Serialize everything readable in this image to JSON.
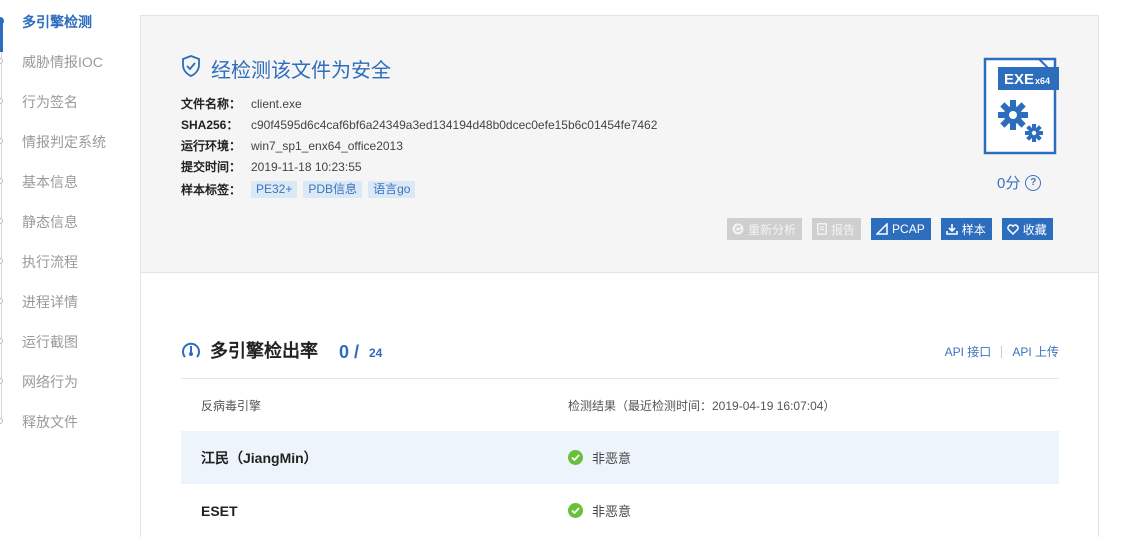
{
  "nav": {
    "items": [
      {
        "label": "多引擎检测",
        "active": true
      },
      {
        "label": "威胁情报IOC",
        "active": false
      },
      {
        "label": "行为签名",
        "active": false
      },
      {
        "label": "情报判定系统",
        "active": false
      },
      {
        "label": "基本信息",
        "active": false
      },
      {
        "label": "静态信息",
        "active": false
      },
      {
        "label": "执行流程",
        "active": false
      },
      {
        "label": "进程详情",
        "active": false
      },
      {
        "label": "运行截图",
        "active": false
      },
      {
        "label": "网络行为",
        "active": false
      },
      {
        "label": "释放文件",
        "active": false
      }
    ]
  },
  "summary": {
    "verdict": "经检测该文件为安全",
    "fields": {
      "filename_key": "文件名称：",
      "filename": "client.exe",
      "sha_key": "SHA256：",
      "sha256": "c90f4595d6c4caf6bf6a24349a3ed134194d48b0dcec0efe15b6c01454fe7462",
      "env_key": "运行环境：",
      "env": "win7_sp1_enx64_office2013",
      "time_key": "提交时间：",
      "time": "2019-11-18 10:23:55",
      "tags_key": "样本标签："
    },
    "tags": [
      "PE32+",
      "PDB信息",
      "语言go"
    ],
    "file_badge": "EXE",
    "file_badge_sub": "x64",
    "score": "0分",
    "help": "?"
  },
  "actions": {
    "reanalyze": "重新分析",
    "report": "报告",
    "pcap": "PCAP",
    "sample": "样本",
    "favorite": "收藏"
  },
  "engines": {
    "title": "多引擎检出率",
    "detected": "0 /",
    "total": "24",
    "api_link": "API 接口",
    "api_upload": "API 上传",
    "col_engine": "反病毒引擎",
    "col_result": "检测结果（最近检测时间：2019-04-19 16:07:04）",
    "rows": [
      {
        "engine": "江民（JiangMin）",
        "result": "非恶意"
      },
      {
        "engine": "ESET",
        "result": "非恶意"
      }
    ]
  },
  "colors": {
    "accent": "#2d6dbd",
    "safe_green": "#6abf3b",
    "disabled_gray": "#cfcfcf"
  }
}
